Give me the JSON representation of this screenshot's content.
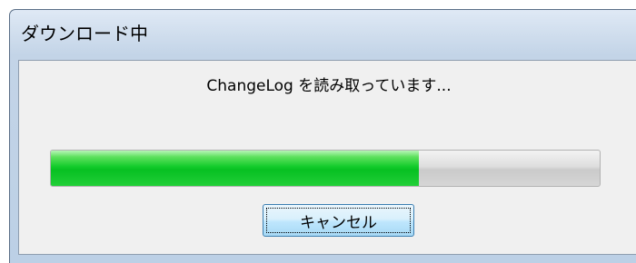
{
  "window": {
    "title": "ダウンロード中"
  },
  "dialog": {
    "message": "ChangeLog を読み取っています..."
  },
  "progress": {
    "value": 0.67,
    "fill_color": "#07c022"
  },
  "buttons": {
    "cancel_label": "キャンセル"
  }
}
